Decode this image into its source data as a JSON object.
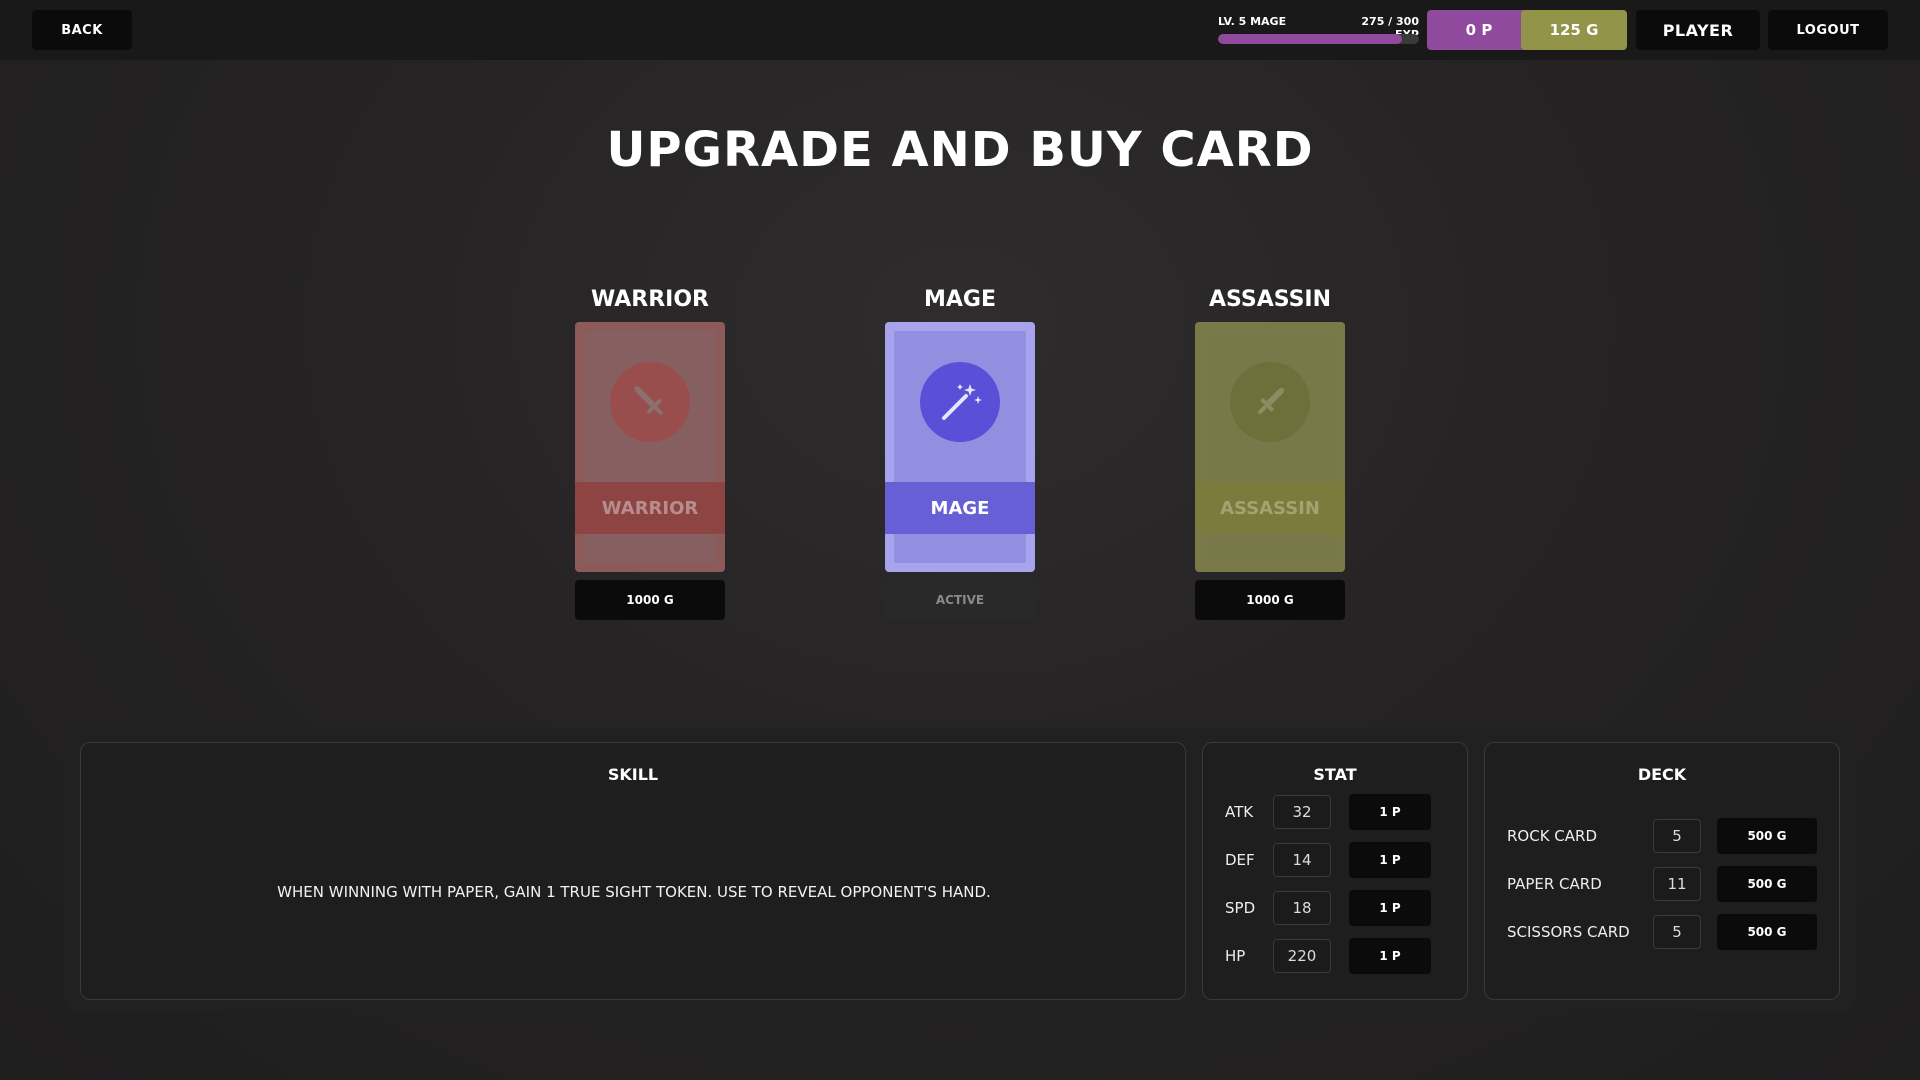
{
  "topbar": {
    "back_label": "BACK",
    "level_label": "LV. 5 MAGE",
    "exp_label": "275 / 300 EXP",
    "exp_fraction": 0.917,
    "points_label": "0 P",
    "gold_label": "125 G",
    "player_label": "PLAYER",
    "logout_label": "LOGOUT"
  },
  "title": "UPGRADE AND BUY CARD",
  "cards": [
    {
      "name": "WARRIOR",
      "band": "WARRIOR",
      "price": "1000 G",
      "icon": "sword-icon",
      "color": "#8f4444"
    },
    {
      "name": "MAGE",
      "band": "MAGE",
      "price": "ACTIVE",
      "icon": "magic-wand-icon",
      "color": "#675fd6"
    },
    {
      "name": "ASSASSIN",
      "band": "ASSASSIN",
      "price": "1000 G",
      "icon": "dagger-icon",
      "color": "#7a7b3c"
    }
  ],
  "skill": {
    "title": "SKILL",
    "text": "WHEN WINNING WITH PAPER, GAIN 1 TRUE SIGHT TOKEN. USE TO REVEAL OPPONENT'S HAND."
  },
  "stat": {
    "title": "STAT",
    "rows": [
      {
        "label": "ATK",
        "value": "32",
        "cost": "1 P"
      },
      {
        "label": "DEF",
        "value": "14",
        "cost": "1 P"
      },
      {
        "label": "SPD",
        "value": "18",
        "cost": "1 P"
      },
      {
        "label": "HP",
        "value": "220",
        "cost": "1 P"
      }
    ]
  },
  "deck": {
    "title": "DECK",
    "rows": [
      {
        "label": "ROCK CARD",
        "value": "5",
        "cost": "500 G"
      },
      {
        "label": "PAPER CARD",
        "value": "11",
        "cost": "500 G"
      },
      {
        "label": "SCISSORS CARD",
        "value": "5",
        "cost": "500 G"
      }
    ]
  }
}
